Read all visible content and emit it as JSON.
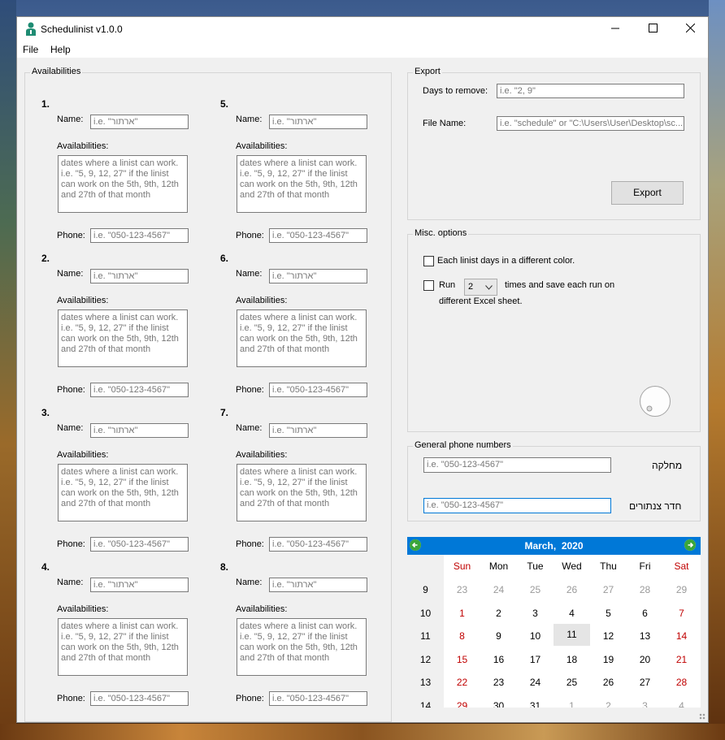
{
  "window": {
    "title": "Schedulinist v1.0.0"
  },
  "menu": [
    "File",
    "Help"
  ],
  "availabilities": {
    "title": "Availabilities",
    "name_label": "Name:",
    "avail_label": "Availabilities:",
    "phone_label": "Phone:",
    "name_placeholder": "i.e. \"ארתור\"",
    "avail_placeholder": "dates where a linist can work. i.e. \"5, 9, 12, 27\" if the linist can work on the 5th, 9th, 12th and 27th of that month",
    "phone_placeholder": "i.e. \"050-123-4567\"",
    "slots": [
      "1.",
      "2.",
      "3.",
      "4.",
      "5.",
      "6.",
      "7.",
      "8."
    ]
  },
  "export": {
    "title": "Export",
    "days_label": "Days to remove:",
    "days_placeholder": "i.e. \"2, 9\"",
    "file_label": "File Name:",
    "file_placeholder": "i.e. \"schedule\" or \"C:\\Users\\User\\Desktop\\sc...",
    "button": "Export"
  },
  "misc": {
    "title": "Misc. options",
    "color_option": "Each linist days in a different color.",
    "run_label": "Run",
    "run_value": "2",
    "run_suffix": "times and save each run on",
    "run_suffix2": "different Excel sheet."
  },
  "phones": {
    "title": "General phone numbers",
    "placeholder": "i.e. \"050-123-4567\"",
    "label1": "מחלקה",
    "label2": "חדר צנתורים"
  },
  "calendar": {
    "month": "March,",
    "year": "2020",
    "weekdays": [
      "Sun",
      "Mon",
      "Tue",
      "Wed",
      "Thu",
      "Fri",
      "Sat"
    ],
    "weeks": [
      {
        "wk": "9",
        "days": [
          "23",
          "24",
          "25",
          "26",
          "27",
          "28",
          "29"
        ]
      },
      {
        "wk": "10",
        "days": [
          "1",
          "2",
          "3",
          "4",
          "5",
          "6",
          "7"
        ]
      },
      {
        "wk": "11",
        "days": [
          "8",
          "9",
          "10",
          "11",
          "12",
          "13",
          "14"
        ]
      },
      {
        "wk": "12",
        "days": [
          "15",
          "16",
          "17",
          "18",
          "19",
          "20",
          "21"
        ]
      },
      {
        "wk": "13",
        "days": [
          "22",
          "23",
          "24",
          "25",
          "26",
          "27",
          "28"
        ]
      },
      {
        "wk": "14",
        "days": [
          "29",
          "30",
          "31",
          "1",
          "2",
          "3",
          "4"
        ]
      }
    ],
    "colors": {
      "header": "#0078d7",
      "weekend": "#c00000",
      "other_month": "#9a9a9a"
    }
  }
}
